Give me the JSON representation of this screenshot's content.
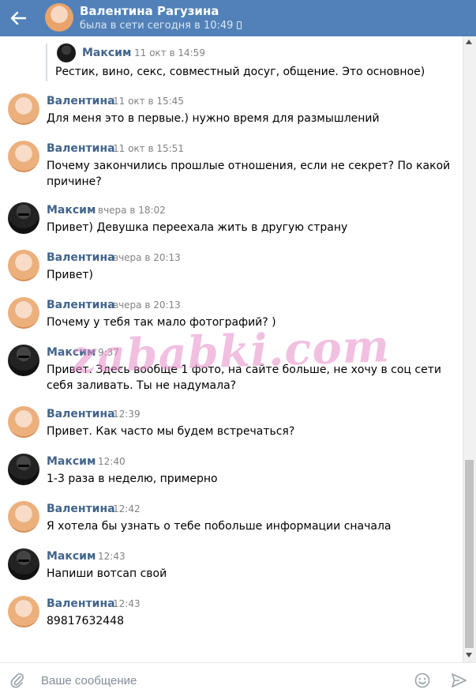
{
  "header": {
    "name": "Валентина Рагузина",
    "status": "была в сети сегодня в 10:49"
  },
  "quote": {
    "author": "Максим",
    "time": "11 окт в 14:59",
    "text": "Рестик, вино, секс, совместный досуг, общение. Это основное)"
  },
  "messages": [
    {
      "author": "Валентина",
      "who": "val",
      "time": "11 окт в 15:45",
      "text": "Для меня это в первые.) нужно время для размышлений"
    },
    {
      "author": "Валентина",
      "who": "val",
      "time": "11 окт в 15:51",
      "text": "Почему закончились прошлые отношения, если не секрет? По какой причине?"
    },
    {
      "author": "Максим",
      "who": "max",
      "time": "вчера в 18:02",
      "text": "Привет) Девушка переехала жить в другую страну"
    },
    {
      "author": "Валентина",
      "who": "val",
      "time": "вчера в 20:13",
      "text": "Привет)"
    },
    {
      "author": "Валентина",
      "who": "val",
      "time": "вчера в 20:13",
      "text": "Почему у тебя так мало фотографий? )"
    },
    {
      "author": "Максим",
      "who": "max",
      "time": "9:37",
      "text": "Привет. Здесь вообще 1 фото, на сайте больше, не хочу в соц сети себя заливать. Ты не надумала?"
    },
    {
      "author": "Валентина",
      "who": "val",
      "time": "12:39",
      "text": "Привет. Как часто мы будем встречаться?"
    },
    {
      "author": "Максим",
      "who": "max",
      "time": "12:40",
      "text": "1-3 раза в неделю, примерно"
    },
    {
      "author": "Валентина",
      "who": "val",
      "time": "12:42",
      "text": "Я хотела бы узнать о тебе побольше информации сначала"
    },
    {
      "author": "Максим",
      "who": "max",
      "time": "12:43",
      "text": "Напиши вотсап свой"
    },
    {
      "author": "Валентина",
      "who": "val",
      "time": "12:43",
      "text": "89817632448"
    }
  ],
  "watermark": "zababki.com",
  "composer": {
    "placeholder": "Ваше сообщение"
  },
  "colors": {
    "header_bg": "#5181b8",
    "author": "#42648b",
    "time": "#828282"
  }
}
